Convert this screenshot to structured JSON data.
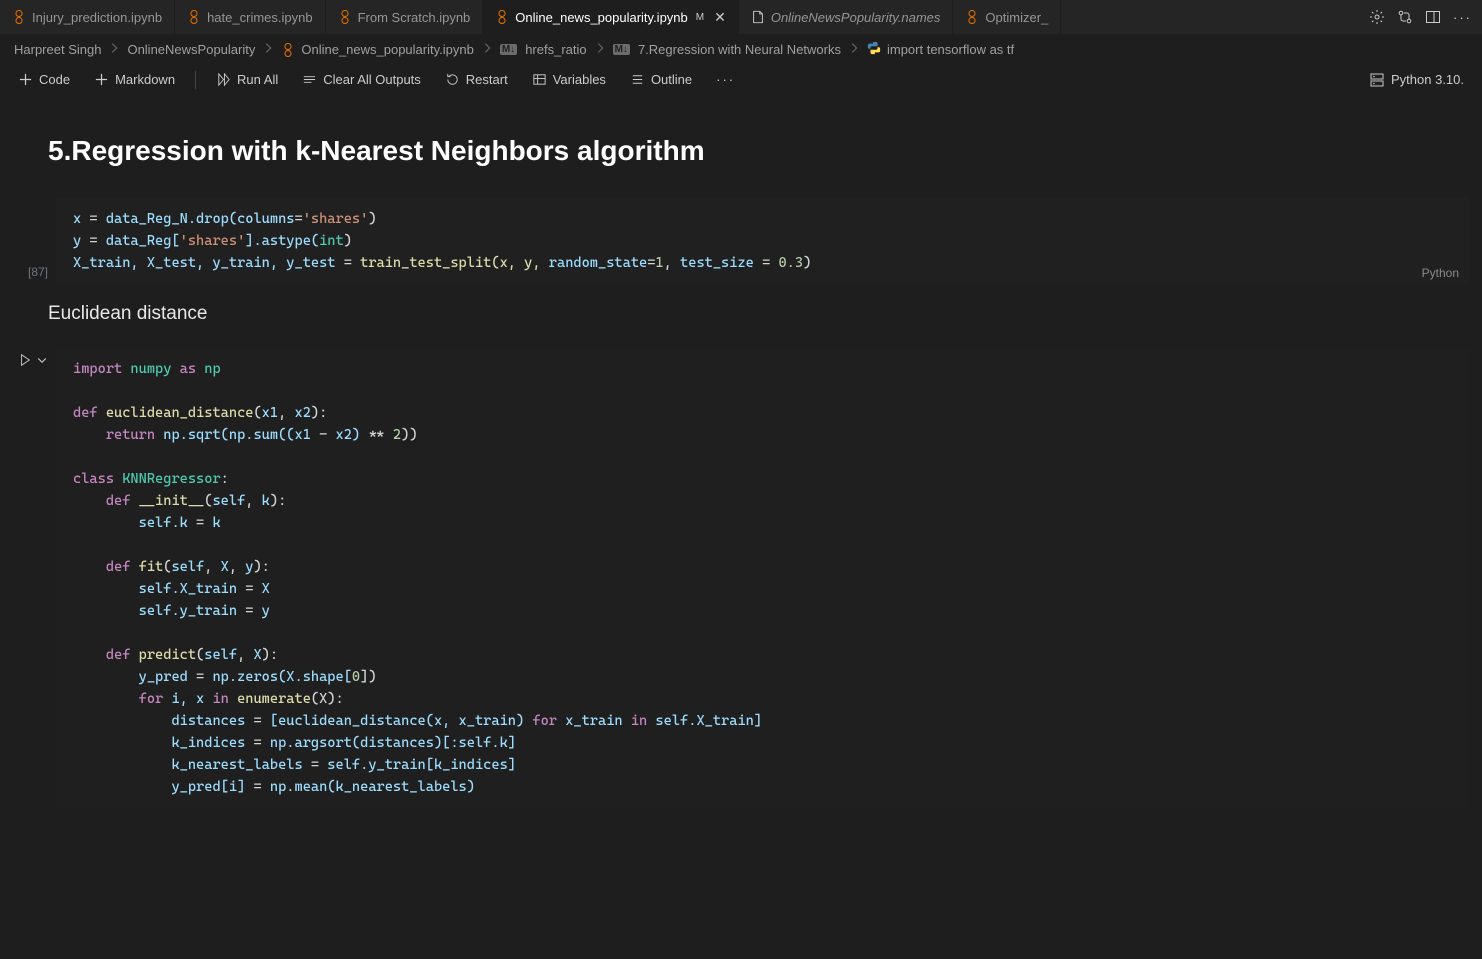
{
  "tabs": {
    "injury": "Injury_prediction.ipynb",
    "hate": "hate_crimes.ipynb",
    "scratch": "From Scratch.ipynb",
    "online": "Online_news_popularity.ipynb",
    "online_dirty": "M",
    "names": "OnlineNewsPopularity.names",
    "opt": "Optimizer_"
  },
  "breadcrumb": {
    "p1": "Harpreet Singh",
    "p2": "OnlineNewsPopularity",
    "p3": "Online_news_popularity.ipynb",
    "p4": "hrefs_ratio",
    "p5": "7.Regression with Neural Networks",
    "p6": "import tensorflow as tf",
    "md_badge": "M↓"
  },
  "toolbar": {
    "code": "Code",
    "markdown": "Markdown",
    "run_all": "Run All",
    "clear": "Clear All Outputs",
    "restart": "Restart",
    "variables": "Variables",
    "outline": "Outline",
    "kernel": "Python 3.10."
  },
  "notebook": {
    "heading1": "5.Regression with k-Nearest Neighbors algorithm",
    "heading2": "Euclidean distance",
    "exec_count_1": "[87]",
    "lang_label": "Python"
  },
  "code1": {
    "l1a": "x ",
    "l1b": "=",
    "l1c": " data_Reg_N.drop(",
    "l1d": "columns",
    "l1e": "=",
    "l1f": "'shares'",
    "l1g": ")",
    "l2a": "y ",
    "l2b": "=",
    "l2c": " data_Reg[",
    "l2d": "'shares'",
    "l2e": "].astype(",
    "l2f": "int",
    "l2g": ")",
    "l3a": "X_train, X_test, y_train, y_test ",
    "l3b": "=",
    "l3c": " train_test_split(x, y, ",
    "l3d": "random_state",
    "l3e": "=",
    "l3f": "1",
    "l3g": ", ",
    "l3h": "test_size",
    "l3i": " = ",
    "l3j": "0.3",
    "l3k": ")"
  },
  "code2": {
    "l1a": "import",
    "l1b": " numpy ",
    "l1c": "as",
    "l1d": " np",
    "l3a": "def",
    "l3b": " euclidean_distance",
    "l3c": "(",
    "l3d": "x1",
    "l3e": ", ",
    "l3f": "x2",
    "l3g": "):",
    "l4a": "    return",
    "l4b": " np.sqrt(np.sum((x1 ",
    "l4c": "-",
    "l4d": " x2) ",
    "l4e": "**",
    "l4f": " 2",
    "l4g": "))",
    "l6a": "class",
    "l6b": " KNNRegressor",
    "l6c": ":",
    "l7a": "    def",
    "l7b": " __init__",
    "l7c": "(",
    "l7d": "self",
    "l7e": ", ",
    "l7f": "k",
    "l7g": "):",
    "l8a": "        self.k ",
    "l8b": "=",
    "l8c": " k",
    "l10a": "    def",
    "l10b": " fit",
    "l10c": "(",
    "l10d": "self",
    "l10e": ", ",
    "l10f": "X",
    "l10g": ", ",
    "l10h": "y",
    "l10i": "):",
    "l11a": "        self.X_train ",
    "l11b": "=",
    "l11c": " X",
    "l12a": "        self.y_train ",
    "l12b": "=",
    "l12c": " y",
    "l14a": "    def",
    "l14b": " predict",
    "l14c": "(",
    "l14d": "self",
    "l14e": ", ",
    "l14f": "X",
    "l14g": "):",
    "l15a": "        y_pred ",
    "l15b": "=",
    "l15c": " np.zeros(X.shape[",
    "l15d": "0",
    "l15e": "])",
    "l16a": "        for",
    "l16b": " i, x ",
    "l16c": "in",
    "l16d": " enumerate",
    "l16e": "(X):",
    "l17a": "            distances ",
    "l17b": "=",
    "l17c": " [euclidean_distance(x, x_train) ",
    "l17d": "for",
    "l17e": " x_train ",
    "l17f": "in",
    "l17g": " self.X_train]",
    "l18a": "            k_indices ",
    "l18b": "=",
    "l18c": " np.argsort(distances)[:self.k]",
    "l19a": "            k_nearest_labels ",
    "l19b": "=",
    "l19c": " self.y_train[k_indices]",
    "l20a": "            y_pred[i] ",
    "l20b": "=",
    "l20c": " np.mean(k_nearest_labels)"
  }
}
